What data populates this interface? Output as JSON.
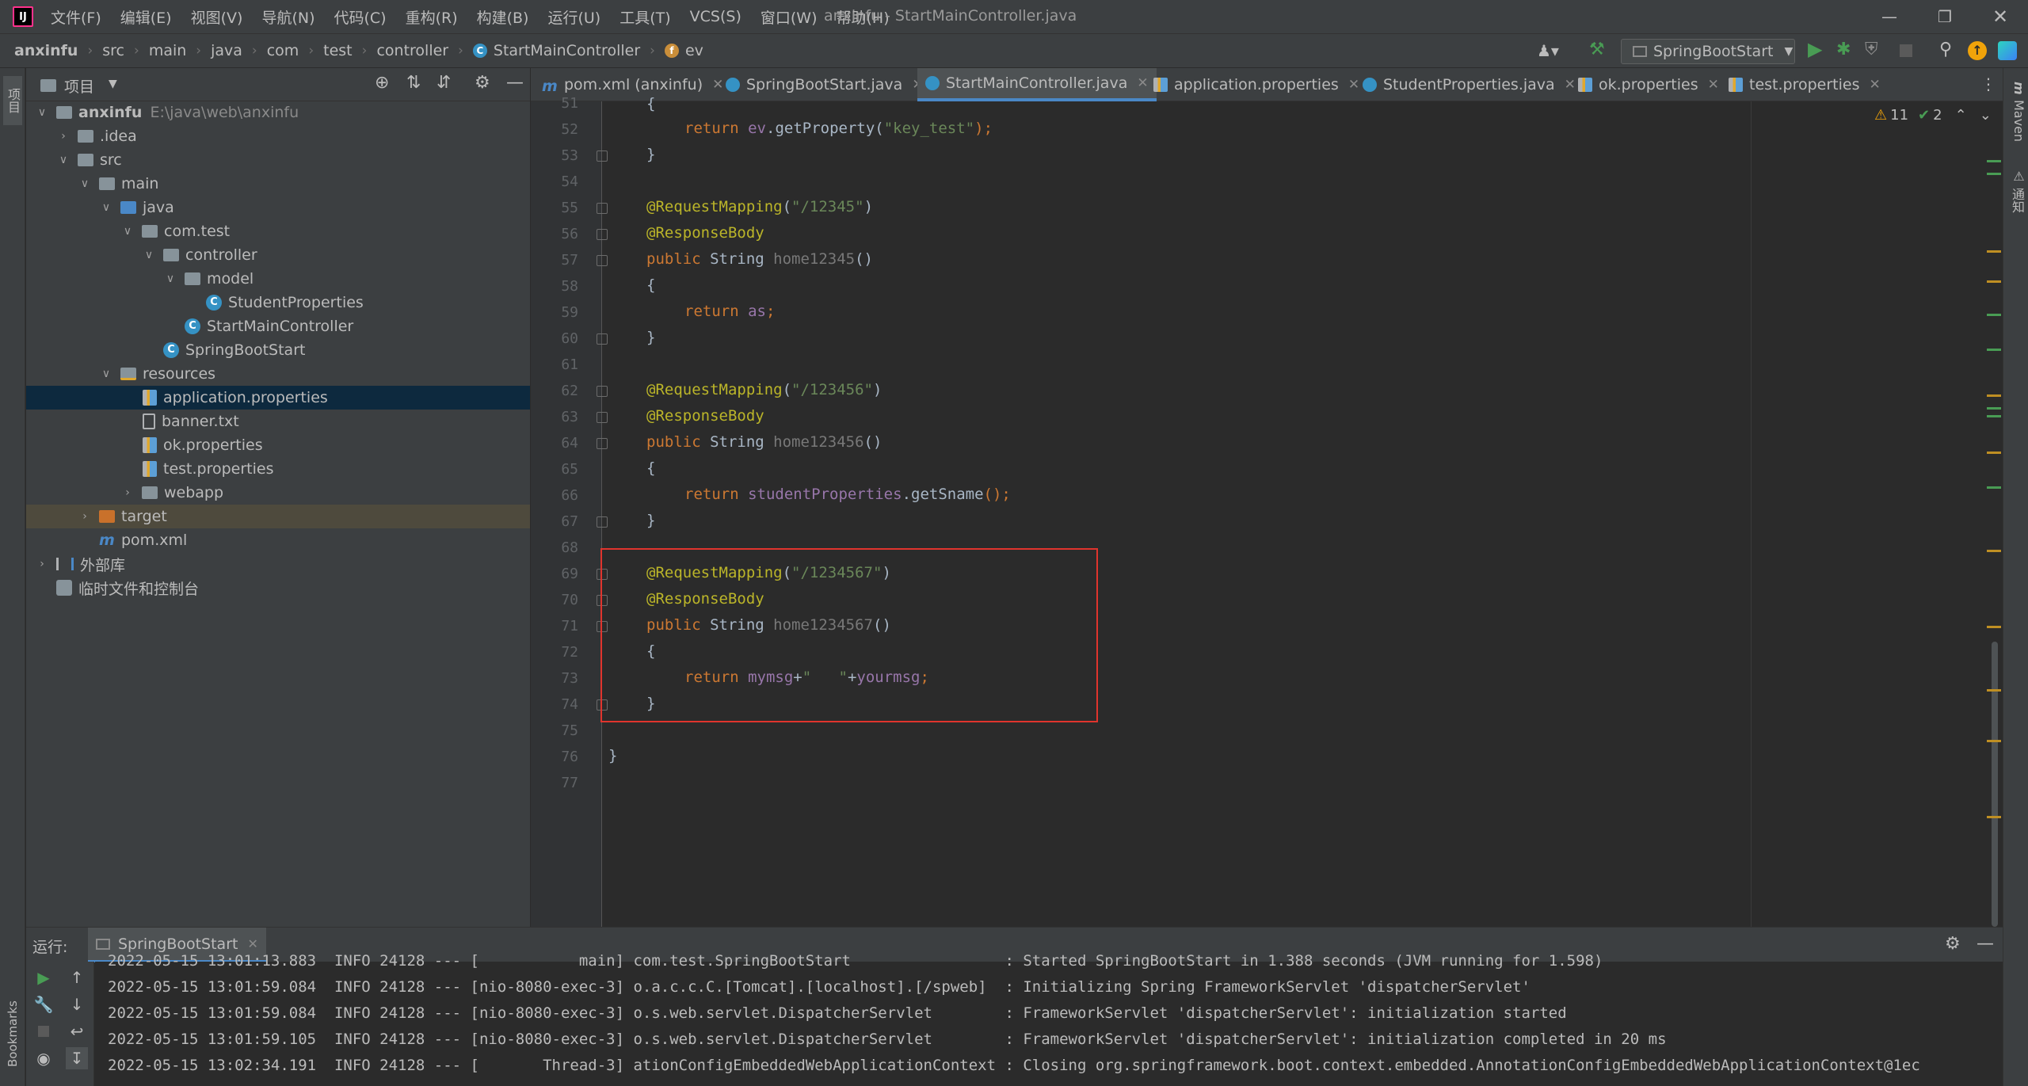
{
  "menu": [
    "文件(F)",
    "编辑(E)",
    "视图(V)",
    "导航(N)",
    "代码(C)",
    "重构(R)",
    "构建(B)",
    "运行(U)",
    "工具(T)",
    "VCS(S)",
    "窗口(W)",
    "帮助(H)"
  ],
  "window_title": "anxinfu - StartMainController.java",
  "breadcrumb": [
    "anxinfu",
    "src",
    "main",
    "java",
    "com",
    "test",
    "controller",
    "StartMainController",
    "ev"
  ],
  "run_config": "SpringBootStart",
  "project_panel": {
    "title": "项目",
    "left_strip_label": "项目",
    "tree": [
      {
        "label": "anxinfu",
        "path": "E:\\java\\web\\anxinfu"
      },
      {
        "label": ".idea"
      },
      {
        "label": "src"
      },
      {
        "label": "main"
      },
      {
        "label": "java"
      },
      {
        "label": "com.test"
      },
      {
        "label": "controller"
      },
      {
        "label": "model"
      },
      {
        "label": "StudentProperties"
      },
      {
        "label": "StartMainController"
      },
      {
        "label": "SpringBootStart"
      },
      {
        "label": "resources"
      },
      {
        "label": "application.properties"
      },
      {
        "label": "banner.txt"
      },
      {
        "label": "ok.properties"
      },
      {
        "label": "test.properties"
      },
      {
        "label": "webapp"
      },
      {
        "label": "target"
      },
      {
        "label": "pom.xml"
      },
      {
        "label": "外部库"
      },
      {
        "label": "临时文件和控制台"
      }
    ]
  },
  "tabs": [
    "pom.xml (anxinfu)",
    "SpringBootStart.java",
    "StartMainController.java",
    "application.properties",
    "StudentProperties.java",
    "ok.properties",
    "test.properties"
  ],
  "inspections": {
    "warnings": "11",
    "ok": "2"
  },
  "right_strip": [
    "Maven",
    "通知"
  ],
  "editor": {
    "line_numbers": [
      "51",
      "52",
      "53",
      "54",
      "55",
      "56",
      "57",
      "58",
      "59",
      "60",
      "61",
      "62",
      "63",
      "64",
      "65",
      "66",
      "67",
      "68",
      "69",
      "70",
      "71",
      "72",
      "73",
      "74",
      "75",
      "76",
      "77"
    ],
    "tokens": {
      "l51": "{",
      "l52_ret": "return",
      "l52_ev": "ev",
      "l52_dot": ".",
      "l52_m": "getProperty",
      "l52_p1": "(",
      "l52_s": "\"key_test\"",
      "l52_p2": ");",
      "l53": "}",
      "l55_a": "@RequestMapping",
      "l55_p1": "(",
      "l55_s": "\"/12345\"",
      "l55_p2": ")",
      "l56": "@ResponseBody",
      "l57_pub": "public",
      "l57_t": " String ",
      "l57_n": "home12345",
      "l57_p": "()",
      "l58": "{",
      "l59_ret": "return",
      "l59_f": "as",
      "l59_s": ";",
      "l60": "}",
      "l62_a": "@RequestMapping",
      "l62_p1": "(",
      "l62_s": "\"/123456\"",
      "l62_p2": ")",
      "l63": "@ResponseBody",
      "l64_pub": "public",
      "l64_t": " String ",
      "l64_n": "home123456",
      "l64_p": "()",
      "l65": "{",
      "l66_ret": "return",
      "l66_f": "studentProperties",
      "l66_dot": ".",
      "l66_m": "getSname",
      "l66_p": "();",
      "l67": "}",
      "l69_a": "@RequestMapping",
      "l69_p1": "(",
      "l69_s": "\"/1234567\"",
      "l69_p2": ")",
      "l70": "@ResponseBody",
      "l71_pub": "public",
      "l71_t": " String ",
      "l71_n": "home1234567",
      "l71_p": "()",
      "l72": "{",
      "l73_ret": "return",
      "l73_f1": "mymsg",
      "l73_plus1": "+",
      "l73_s": "\"   \"",
      "l73_plus2": "+",
      "l73_f2": "yourmsg",
      "l73_semi": ";",
      "l74": "}",
      "l76": "}"
    }
  },
  "run_panel": {
    "label": "运行:",
    "tab": "SpringBootStart",
    "bookmarks": "Bookmarks",
    "lines": [
      "2022-05-15 13:01:13.883  INFO 24128 --- [           main] com.test.SpringBootStart                 : Started SpringBootStart in 1.388 seconds (JVM running for 1.598)",
      "2022-05-15 13:01:59.084  INFO 24128 --- [nio-8080-exec-3] o.a.c.c.C.[Tomcat].[localhost].[/spweb]  : Initializing Spring FrameworkServlet 'dispatcherServlet'",
      "2022-05-15 13:01:59.084  INFO 24128 --- [nio-8080-exec-3] o.s.web.servlet.DispatcherServlet        : FrameworkServlet 'dispatcherServlet': initialization started",
      "2022-05-15 13:01:59.105  INFO 24128 --- [nio-8080-exec-3] o.s.web.servlet.DispatcherServlet        : FrameworkServlet 'dispatcherServlet': initialization completed in 20 ms",
      "2022-05-15 13:02:34.191  INFO 24128 --- [       Thread-3] ationConfigEmbeddedWebApplicationContext : Closing org.springframework.boot.context.embedded.AnnotationConfigEmbeddedWebApplicationContext@1ec"
    ]
  },
  "colors": {
    "accent": "#4a88c7",
    "selection": "#0d293e",
    "highlight_box": "#e0342d",
    "warning": "#f0a30a",
    "run_green": "#499c54"
  }
}
